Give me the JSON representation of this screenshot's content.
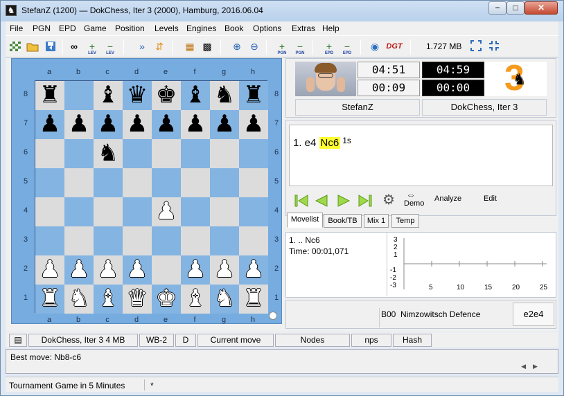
{
  "window": {
    "title": "StefanZ (1200)  —  DokChess, Iter 3 (2000),   Hamburg,   2016.06.04",
    "min_glyph": "−",
    "max_glyph": "□",
    "close_glyph": "✕"
  },
  "menu": [
    "File",
    "PGN",
    "EPD",
    "Game",
    "Position",
    "Levels",
    "Engines",
    "Book",
    "Options",
    "Extras",
    "Help"
  ],
  "toolbar": {
    "memory": "1.727 MB",
    "lev_add_sub": "LEV",
    "lev_rem_sub": "LEV",
    "pgn_add_sub": "PGN",
    "pgn_rem_sub": "PGN",
    "epd_add_sub": "EPD",
    "epd_rem_sub": "EPD",
    "dgt_label": "DGT"
  },
  "board": {
    "files": [
      "a",
      "b",
      "c",
      "d",
      "e",
      "f",
      "g",
      "h"
    ],
    "ranks": [
      "8",
      "7",
      "6",
      "5",
      "4",
      "3",
      "2",
      "1"
    ],
    "colors": {
      "light": "#dcdcdc",
      "dark": "#84b4e2",
      "frame": "#76ace0"
    },
    "position": [
      [
        "bR",
        "",
        "bB",
        "bQ",
        "bK",
        "bB",
        "bN",
        "bR"
      ],
      [
        "bP",
        "bP",
        "bP",
        "bP",
        "bP",
        "bP",
        "bP",
        "bP"
      ],
      [
        "",
        "",
        "bN",
        "",
        "",
        "",
        "",
        ""
      ],
      [
        "",
        "",
        "",
        "",
        "",
        "",
        "",
        ""
      ],
      [
        "",
        "",
        "",
        "",
        "wP",
        "",
        "",
        ""
      ],
      [
        "",
        "",
        "",
        "",
        "",
        "",
        "",
        ""
      ],
      [
        "wP",
        "wP",
        "wP",
        "wP",
        "",
        "wP",
        "wP",
        "wP"
      ],
      [
        "wR",
        "wN",
        "wB",
        "wQ",
        "wK",
        "wB",
        "wN",
        "wR"
      ]
    ]
  },
  "players": {
    "white_name": "StefanZ",
    "black_name": "DokChess, Iter 3",
    "white_clock": "04:51",
    "white_move_clock": "00:09",
    "black_clock": "04:59",
    "black_move_clock": "00:00",
    "engine_logo": "3"
  },
  "moves": {
    "prefix": "1. e4 ",
    "current": "Nc6",
    "time": "1s"
  },
  "nav": {
    "demo": "Demo",
    "analyze": "Analyze",
    "edit": "Edit"
  },
  "tabs": [
    "Movelist",
    "Book/TB",
    "Mix 1",
    "Temp"
  ],
  "analysis": {
    "line1": "1. .. Nc6",
    "line2": "Time: 00:01,071",
    "y_ticks": [
      "3",
      "2",
      "1",
      "-1",
      "-2",
      "-3"
    ],
    "x_ticks": [
      "5",
      "10",
      "15",
      "20",
      "25"
    ]
  },
  "opening": {
    "eco": "B00",
    "name": "Nimzowitsch Defence",
    "last_move": "e2e4"
  },
  "engine_bar": {
    "engine": "DokChess, Iter 3  4 MB",
    "wb": "WB-2",
    "d": "D",
    "current_move": "Current move",
    "nodes": "Nodes",
    "nps": "nps",
    "hash": "Hash"
  },
  "best_move": "Best move: Nb8-c6",
  "status": {
    "text": "Tournament Game in 5 Minutes",
    "star": "*"
  }
}
